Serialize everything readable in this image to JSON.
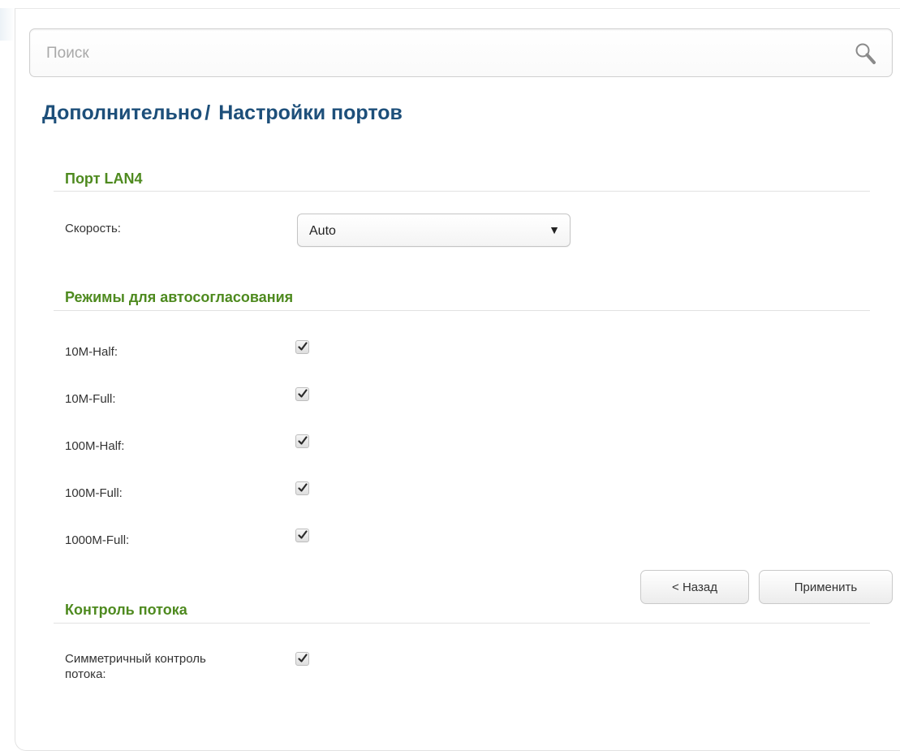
{
  "search": {
    "placeholder": "Поиск"
  },
  "breadcrumb": {
    "parent": "Дополнительно",
    "separator": "/",
    "current": "Настройки портов"
  },
  "sections": {
    "port": {
      "title": "Порт LAN4",
      "speed_label": "Скорость:",
      "speed_value": "Auto"
    },
    "autoneg": {
      "title": "Режимы для автосогласования",
      "modes": [
        {
          "label": "10M-Half:",
          "checked": true
        },
        {
          "label": "10M-Full:",
          "checked": true
        },
        {
          "label": "100M-Half:",
          "checked": true
        },
        {
          "label": "100M-Full:",
          "checked": true
        },
        {
          "label": "1000M-Full:",
          "checked": true
        }
      ]
    },
    "flow": {
      "title": "Контроль потока",
      "sym_label_line1": "Симметричный контроль",
      "sym_label_line2": "потока:",
      "sym_checked": true
    }
  },
  "buttons": {
    "back": "< Назад",
    "apply": "Применить"
  },
  "colors": {
    "title": "#1d4f7a",
    "section": "#4e8a1f"
  }
}
